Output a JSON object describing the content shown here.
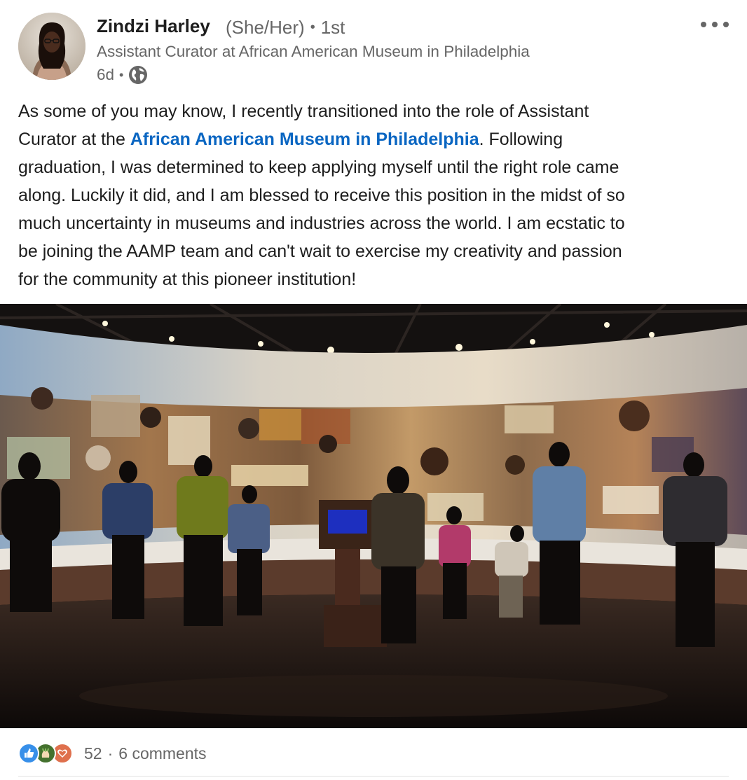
{
  "author": {
    "name": "Zindzi Harley",
    "pronouns": "(She/Her)",
    "connection_degree": "1st",
    "headline": "Assistant Curator at African American Museum in Philadelphia",
    "time_ago": "6d",
    "visibility_icon": "globe-icon"
  },
  "post": {
    "lines": [
      "As some of you may know, I recently transitioned into the role of Assistant",
      "Curator at the ",
      ". Following",
      "graduation, I was determined to keep applying myself until the right role came",
      "along. Luckily it did, and I am blessed to receive this position in the midst of so",
      "much uncertainty in museums and industries across the world. I am ecstatic to",
      "be joining the AAMP team and can't wait to exercise my creativity and passion",
      "for the community at this pioneer institution!"
    ],
    "mention": "African American Museum in Philadelphia"
  },
  "social": {
    "reaction_icons": [
      "like-icon",
      "celebrate-icon",
      "love-icon"
    ],
    "reaction_count": "52",
    "separator": "·",
    "comments": "6 comments"
  },
  "colors": {
    "link": "#0a66c2",
    "secondary_text": "#666666",
    "like": "#378fe9",
    "celebrate": "#44712e",
    "love": "#df704d"
  }
}
